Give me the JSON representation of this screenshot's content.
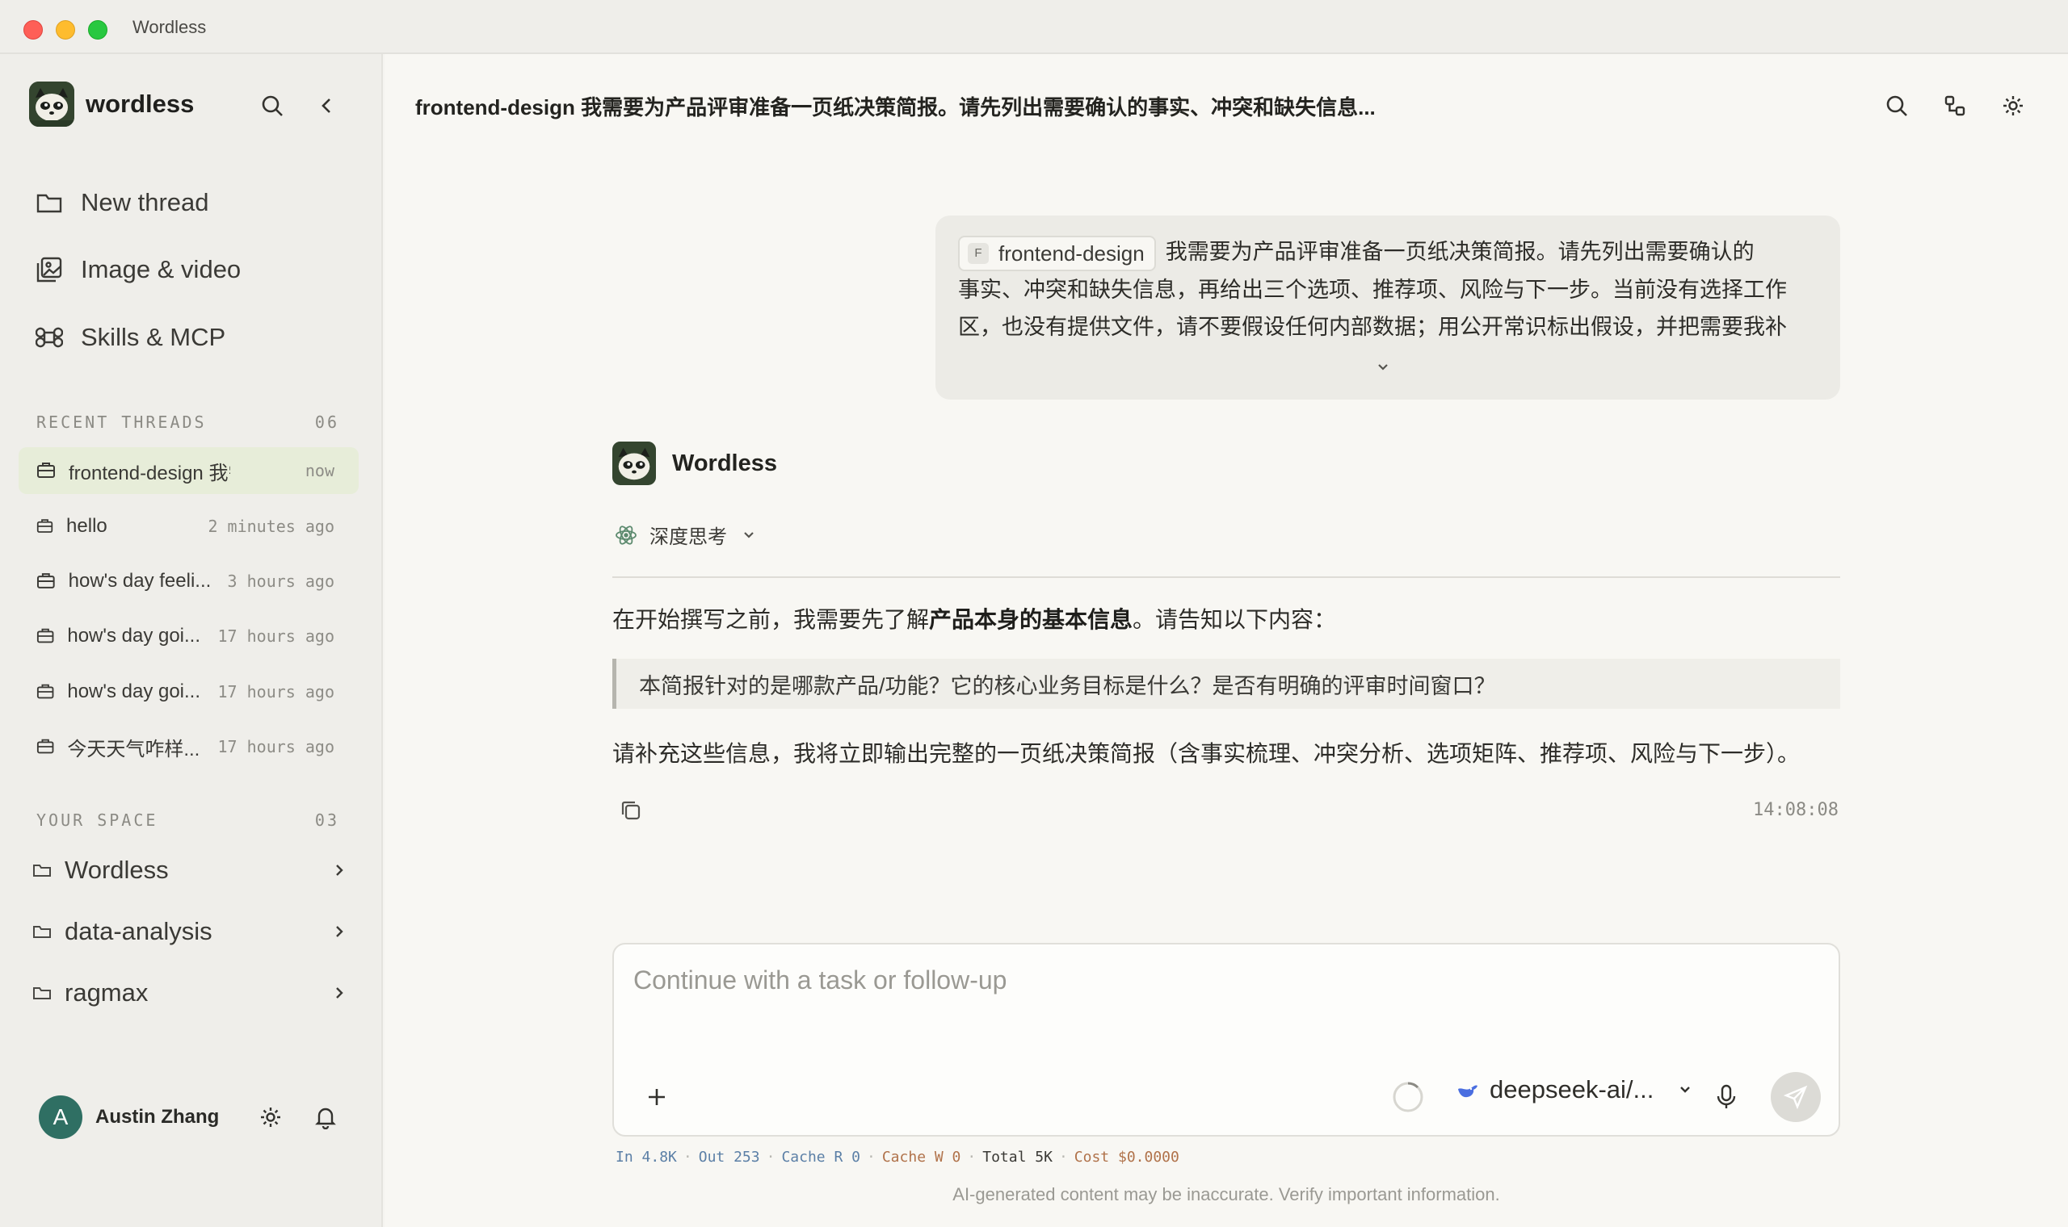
{
  "window": {
    "title": "Wordless"
  },
  "sidebar": {
    "brand": "wordless",
    "nav": [
      {
        "label": "New thread",
        "icon": "folder-icon"
      },
      {
        "label": "Image & video",
        "icon": "image-video-icon"
      },
      {
        "label": "Skills & MCP",
        "icon": "command-icon"
      }
    ],
    "recent_threads": {
      "heading": "RECENT THREADS",
      "count": "06",
      "items": [
        {
          "label": "frontend-design 我需要...",
          "time": "now",
          "active": true
        },
        {
          "label": "hello",
          "time": "2 minutes ago"
        },
        {
          "label": "how's day feeli...",
          "time": "3 hours ago"
        },
        {
          "label": "how's day goi...",
          "time": "17 hours ago"
        },
        {
          "label": "how's day goi...",
          "time": "17 hours ago"
        },
        {
          "label": "今天天气咋样...",
          "time": "17 hours ago"
        }
      ]
    },
    "your_space": {
      "heading": "YOUR SPACE",
      "count": "03",
      "items": [
        {
          "label": "Wordless"
        },
        {
          "label": "data-analysis"
        },
        {
          "label": "ragmax"
        }
      ]
    },
    "user": {
      "initial": "A",
      "name": "Austin Zhang"
    }
  },
  "main": {
    "title": "frontend-design 我需要为产品评审准备一页纸决策简报。请先列出需要确认的事实、冲突和缺失信息...",
    "user_message": {
      "chip": "frontend-design",
      "chip_letter": "F",
      "line1": "我需要为产品评审准备一页纸决策简报。请先列出需要确认的",
      "line2": "事实、冲突和缺失信息，再给出三个选项、推荐项、风险与下一步。当前没有选择工作",
      "line3": "区，也没有提供文件，请不要假设任何内部数据；用公开常识标出假设，并把需要我补"
    },
    "assistant": {
      "name": "Wordless",
      "thinking_label": "深度思考",
      "para1_prefix": "在开始撰写之前，我需要先了解",
      "para1_bold": "产品本身的基本信息",
      "para1_suffix": "。请告知以下内容：",
      "quote": "本简报针对的是哪款产品/功能？它的核心业务目标是什么？是否有明确的评审时间窗口？",
      "para2": "请补充这些信息，我将立即输出完整的一页纸决策简报（含事实梳理、冲突分析、选项矩阵、推荐项、风险与下一步）。",
      "timestamp": "14:08:08"
    },
    "composer": {
      "placeholder": "Continue with a task or follow-up",
      "model": "deepseek-ai/..."
    },
    "usage": {
      "in_label": "In",
      "in_value": "4.8K",
      "out_label": "Out",
      "out_value": "253",
      "cache_r_label": "Cache R",
      "cache_r_value": "0",
      "cache_w_label": "Cache W",
      "cache_w_value": "0",
      "total_label": "Total",
      "total_value": "5K",
      "cost_label": "Cost",
      "cost_value": "$0.0000"
    },
    "disclaimer": "AI-generated content may be inaccurate. Verify important information."
  }
}
